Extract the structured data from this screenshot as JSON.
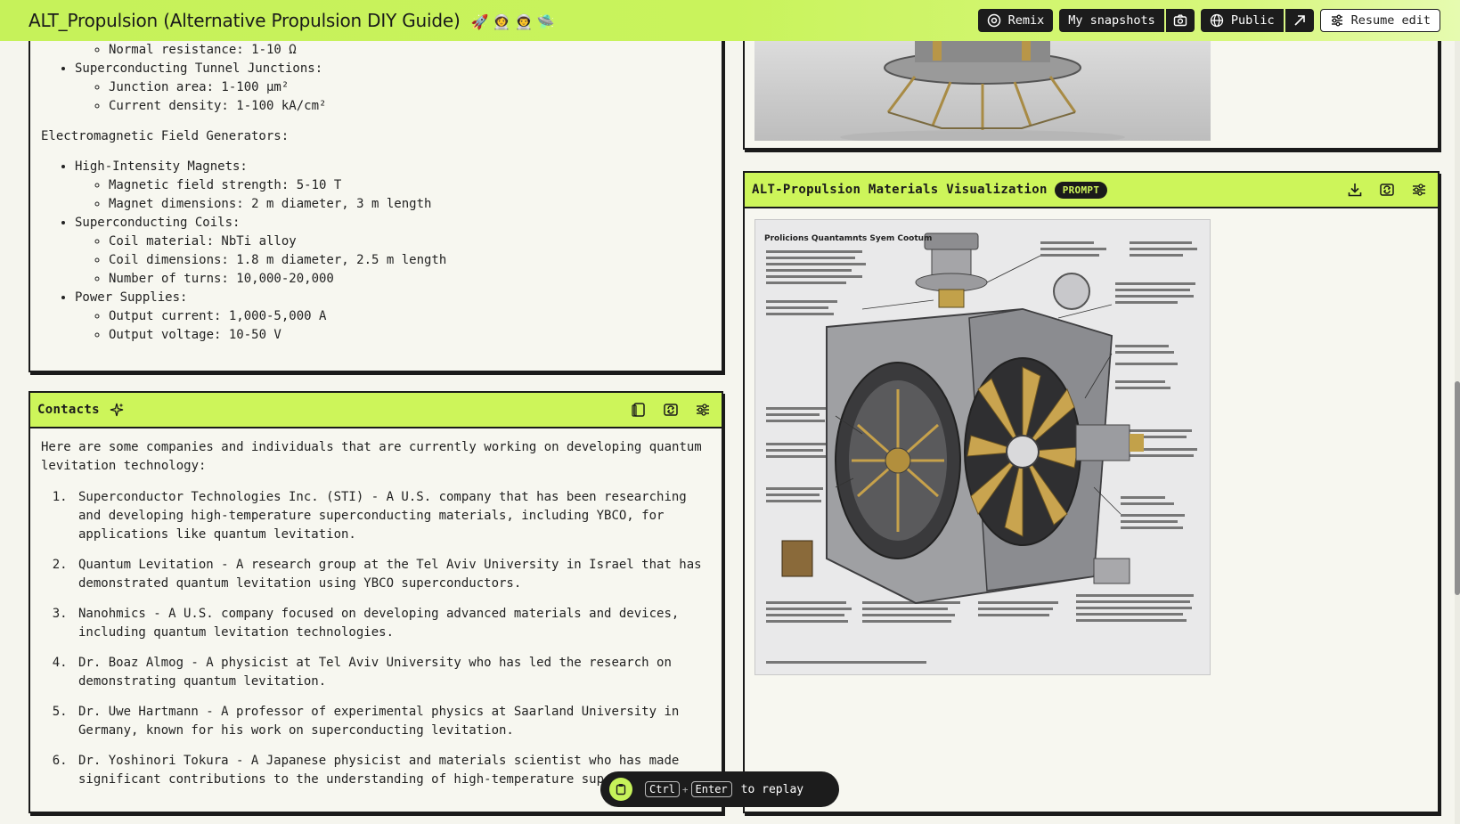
{
  "app": {
    "title": "ALT_Propulsion (Alternative Propulsion DIY Guide)",
    "title_emojis": "🚀 👩‍🚀 👨‍🚀 🛸"
  },
  "header": {
    "remix_label": "Remix",
    "snapshots_label": "My snapshots",
    "visibility_label": "Public",
    "resume_label": "Resume edit"
  },
  "top_left_panel": {
    "first_line_item": "Normal resistance: 1-10 Ω",
    "stj_label": "Superconducting Tunnel Junctions:",
    "stj_items": [
      "Junction area: 1-100 μm²",
      "Current density: 1-100 kA/cm²"
    ],
    "emf_heading": "Electromagnetic Field Generators:",
    "groups": [
      {
        "label": "High-Intensity Magnets:",
        "items": [
          "Magnetic field strength: 5-10 T",
          "Magnet dimensions: 2 m diameter, 3 m length"
        ]
      },
      {
        "label": "Superconducting Coils:",
        "items": [
          "Coil material: NbTi alloy",
          "Coil dimensions: 1.8 m diameter, 2.5 m length",
          "Number of turns: 10,000-20,000"
        ]
      },
      {
        "label": "Power Supplies:",
        "items": [
          "Output current: 1,000-5,000 A",
          "Output voltage: 10-50 V"
        ]
      }
    ]
  },
  "contacts": {
    "title": "Contacts",
    "intro": "Here are some companies and individuals that are currently working on developing quantum levitation technology:",
    "items": [
      "Superconductor Technologies Inc. (STI) - A U.S. company that has been researching and developing high-temperature superconducting materials, including YBCO, for applications like quantum levitation.",
      "Quantum Levitation - A research group at the Tel Aviv University in Israel that has demonstrated quantum levitation using YBCO superconductors.",
      "Nanohmics - A U.S. company focused on developing advanced materials and devices, including quantum levitation technologies.",
      "Dr. Boaz Almog - A physicist at Tel Aviv University who has led the research on demonstrating quantum levitation.",
      "Dr. Uwe Hartmann - A professor of experimental physics at Saarland University in Germany, known for his work on superconducting levitation.",
      "Dr. Yoshinori Tokura - A Japanese physicist and materials scientist who has made significant contributions to the understanding of high-temperature superconductors."
    ]
  },
  "visualization": {
    "title": "ALT-Propulsion Materials Visualization",
    "badge": "PROMPT",
    "image_heading": "Prolicions Quantamnts Syem Cootum"
  },
  "replay": {
    "key1": "Ctrl",
    "plus": "+",
    "key2": "Enter",
    "text": "to replay"
  },
  "icons": [
    "remix-icon",
    "camera-icon",
    "globe-icon",
    "arrow-right-icon",
    "sliders-icon",
    "sparkle-icon",
    "copy-icon",
    "regenerate-icon",
    "download-icon",
    "clipboard-icon"
  ],
  "colors": {
    "accent": "#cdf55a",
    "dark": "#1a1a1a",
    "bg": "#f5f5ee"
  }
}
